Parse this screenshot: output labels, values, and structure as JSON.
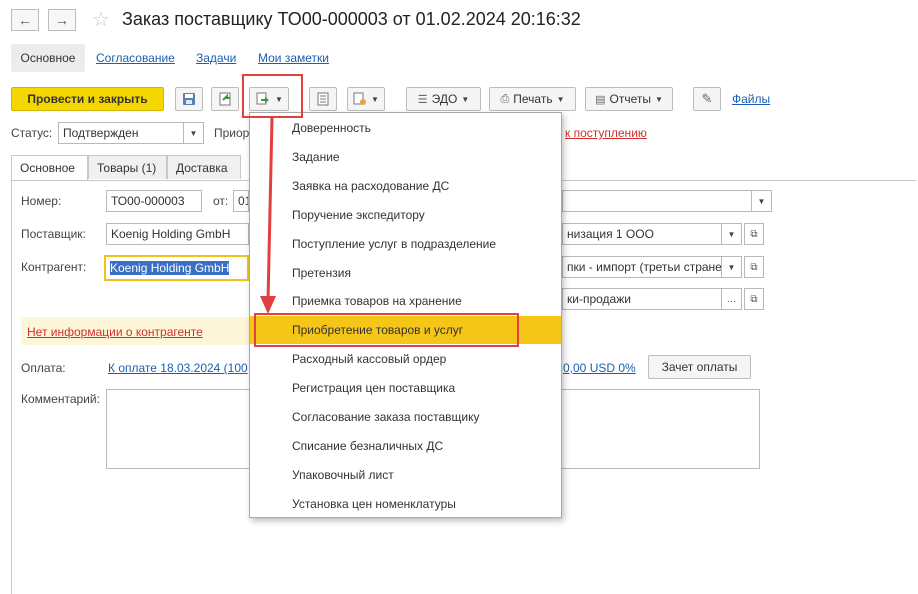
{
  "window": {
    "title": "Заказ поставщику ТО00-000003 от 01.02.2024 20:16:32",
    "back_icon": "←",
    "forward_icon": "→",
    "star_icon": "☆"
  },
  "sections": {
    "main": "Основное",
    "approval": "Согласование",
    "tasks": "Задачи",
    "notes": "Мои заметки"
  },
  "toolbar": {
    "post_close": "Провести и закрыть",
    "edo": "ЭДО",
    "print": "Печать",
    "reports": "Отчеты",
    "files": "Файлы"
  },
  "status_row": {
    "status_label": "Статус:",
    "status_value": "Подтвержден",
    "priority_label": "Приор",
    "receipt_link": "к поступлению"
  },
  "form_tabs": [
    "Основное",
    "Товары (1)",
    "Доставка"
  ],
  "form": {
    "number_label": "Номер:",
    "number_value": "ТО00-000003",
    "from_label": "от:",
    "date_value": "01",
    "supplier_label": "Поставщик:",
    "supplier_value": "Koenig Holding GmbH",
    "counterparty_label": "Контрагент:",
    "counterparty_value": "Koenig Holding GmbH",
    "org_value": "низация 1 ООО",
    "op_value": "пки - импорт (третьи стране",
    "contract_value": "ки-продажи",
    "no_info_link": "Нет информации о контрагенте",
    "payment_label": "Оплата:",
    "payment_link": "К оплате 18.03.2024 (100",
    "payment_amount": "0,00 USD 0%",
    "offset_button": "Зачет оплаты",
    "comment_label": "Комментарий:"
  },
  "menu": {
    "items": [
      "Доверенность",
      "Задание",
      "Заявка на расходование ДС",
      "Поручение экспедитору",
      "Поступление услуг в подразделение",
      "Претензия",
      "Приемка товаров на хранение",
      "Приобретение товаров и услуг",
      "Расходный кассовый ордер",
      "Регистрация цен поставщика",
      "Согласование заказа поставщику",
      "Списание безналичных ДС",
      "Упаковочный лист",
      "Установка цен номенклатуры"
    ],
    "highlighted_index": 7,
    "highlight_color": "#f5c518"
  },
  "annotation_color": "#e04040"
}
